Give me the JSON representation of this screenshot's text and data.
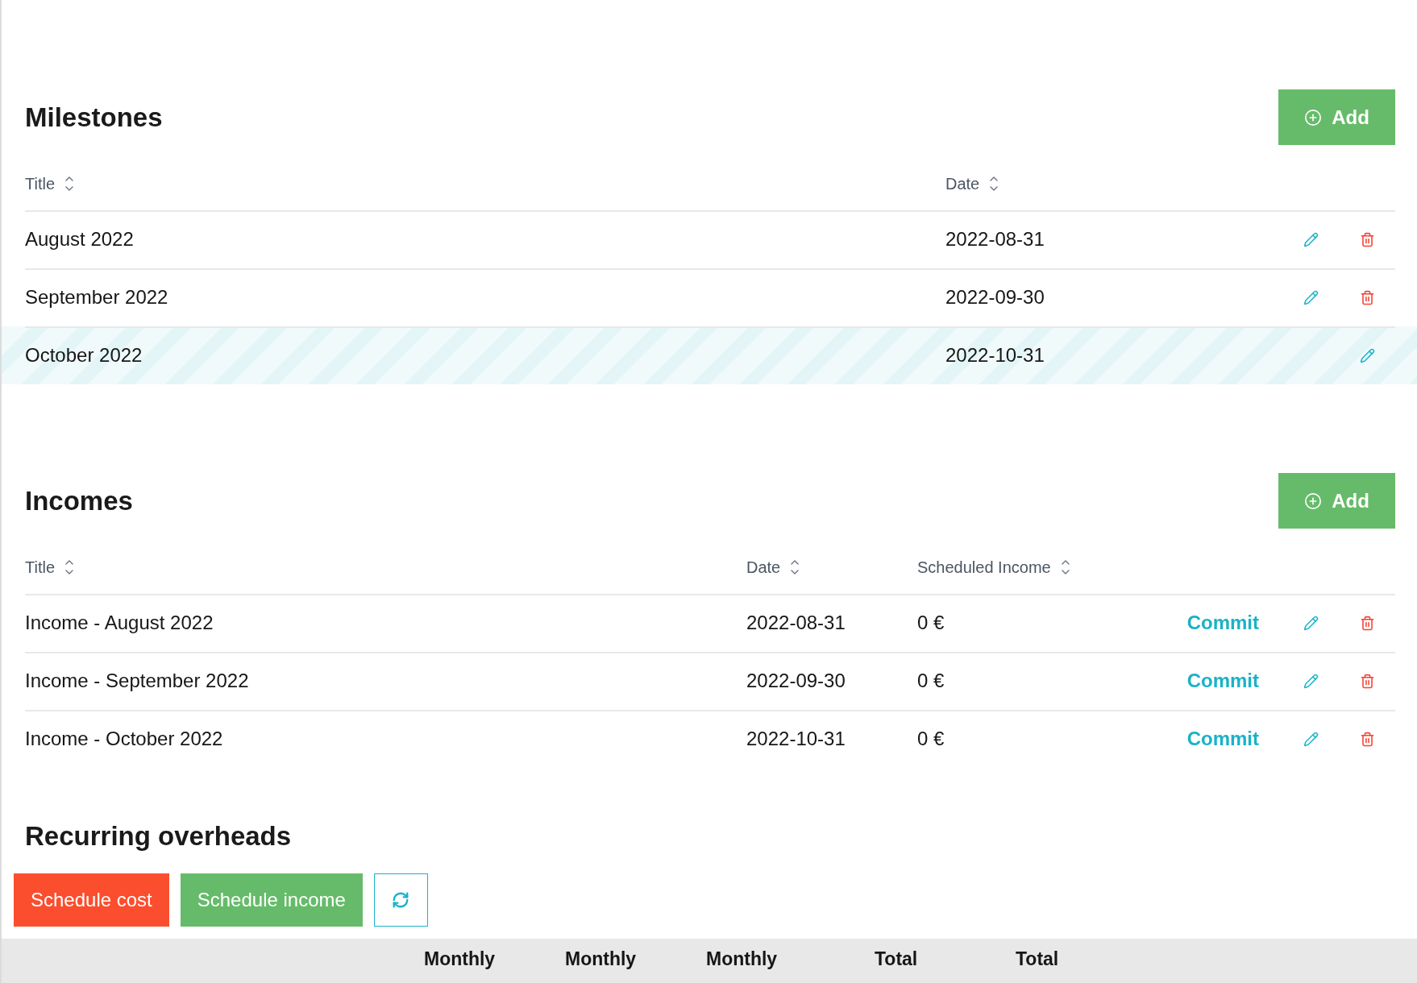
{
  "milestones": {
    "title": "Milestones",
    "add_button": {
      "label": "Add"
    },
    "columns": [
      {
        "label": "Title",
        "sortable": true
      },
      {
        "label": "Date",
        "sortable": true
      }
    ],
    "rows": [
      {
        "title": "August 2022",
        "date": "2022-08-31",
        "highlighted": false,
        "deletable": true
      },
      {
        "title": "September 2022",
        "date": "2022-09-30",
        "highlighted": false,
        "deletable": true
      },
      {
        "title": "October 2022",
        "date": "2022-10-31",
        "highlighted": true,
        "deletable": false
      }
    ]
  },
  "incomes": {
    "title": "Incomes",
    "add_button": {
      "label": "Add"
    },
    "columns": [
      {
        "label": "Title",
        "sortable": true
      },
      {
        "label": "Date",
        "sortable": true
      },
      {
        "label": "Scheduled Income",
        "sortable": true
      }
    ],
    "rows": [
      {
        "title": "Income - August 2022",
        "date": "2022-08-31",
        "scheduled_income": "0 €",
        "action": "Commit"
      },
      {
        "title": "Income - September 2022",
        "date": "2022-09-30",
        "scheduled_income": "0 €",
        "action": "Commit"
      },
      {
        "title": "Income - October 2022",
        "date": "2022-10-31",
        "scheduled_income": "0 €",
        "action": "Commit"
      }
    ]
  },
  "recurring_overheads": {
    "title": "Recurring overheads",
    "buttons": [
      {
        "kind": "cost",
        "label": "Schedule cost"
      },
      {
        "kind": "income",
        "label": "Schedule income"
      },
      {
        "kind": "refresh"
      }
    ],
    "table": {
      "columns": [
        {
          "label": "Monthly"
        },
        {
          "label": "Monthly"
        },
        {
          "label": "Monthly"
        },
        {
          "label": "Total"
        },
        {
          "label": "Total"
        }
      ]
    }
  }
}
